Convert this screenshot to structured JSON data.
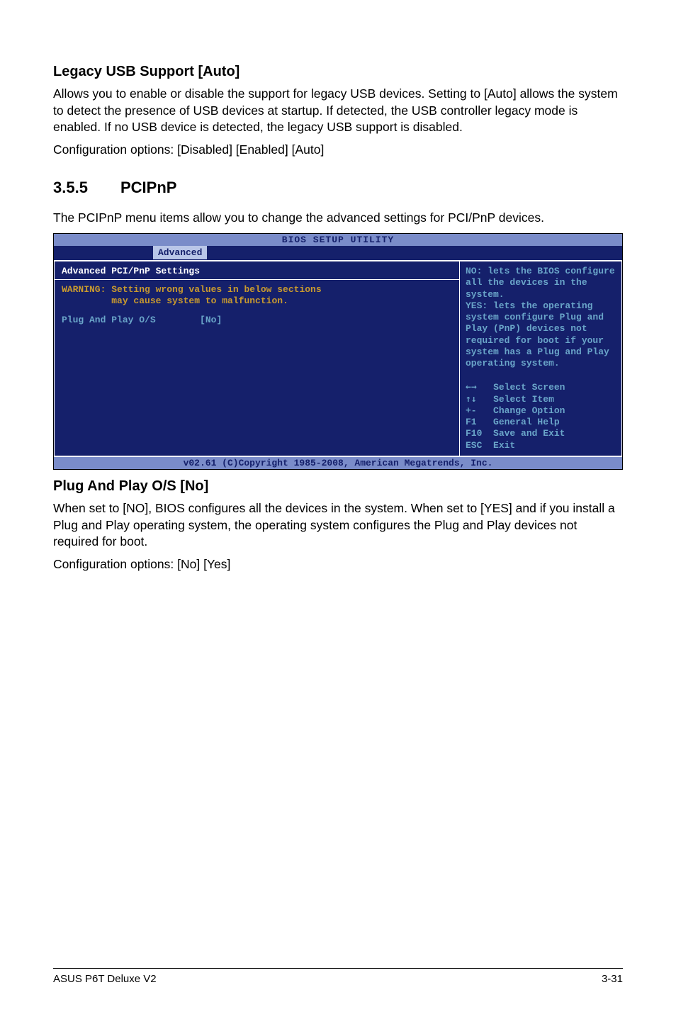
{
  "section1": {
    "head": "Legacy USB Support [Auto]",
    "p1": "Allows you to enable or disable the support for legacy USB devices. Setting to [Auto] allows the system to detect the presence of USB devices at startup. If detected, the USB controller legacy mode is enabled. If no USB device is detected, the legacy USB support is disabled.",
    "p2": "Configuration options: [Disabled] [Enabled] [Auto]"
  },
  "subsection": {
    "num": "3.5.5",
    "title": "PCIPnP",
    "intro": "The PCIPnP menu items allow you to change the advanced settings for PCI/PnP devices."
  },
  "bios": {
    "title": "BIOS SETUP UTILITY",
    "tab": "Advanced",
    "left_title": "Advanced PCI/PnP Settings",
    "warning": "WARNING: Setting wrong values in below sections\n         may cause system to malfunction.",
    "item_label": "Plug And Play O/S",
    "item_value": "[No]",
    "help": "NO: lets the BIOS configure all the devices in the system.\nYES: lets the operating system configure Plug and Play (PnP) devices not required for boot if your system has a Plug and Play operating system.",
    "keys": {
      "k1": {
        "sym": "←→",
        "label": "Select Screen"
      },
      "k2": {
        "sym": "↑↓",
        "label": "Select Item"
      },
      "k3": {
        "sym": "+-",
        "label": " Change Option"
      },
      "k4": {
        "sym": "F1",
        "label": " General Help"
      },
      "k5": {
        "sym": "F10",
        "label": "Save and Exit"
      },
      "k6": {
        "sym": "ESC",
        "label": "Exit"
      }
    },
    "footer": "v02.61 (C)Copyright 1985-2008, American Megatrends, Inc."
  },
  "section2": {
    "head": "Plug And Play O/S [No]",
    "p1": "When set to [NO], BIOS configures all the devices in the system. When set to [YES] and if you install a Plug and Play operating system, the operating system configures the Plug and Play devices not required for boot.",
    "p2": "Configuration options: [No] [Yes]"
  },
  "footer": {
    "left": "ASUS P6T Deluxe V2",
    "right": "3-31"
  }
}
